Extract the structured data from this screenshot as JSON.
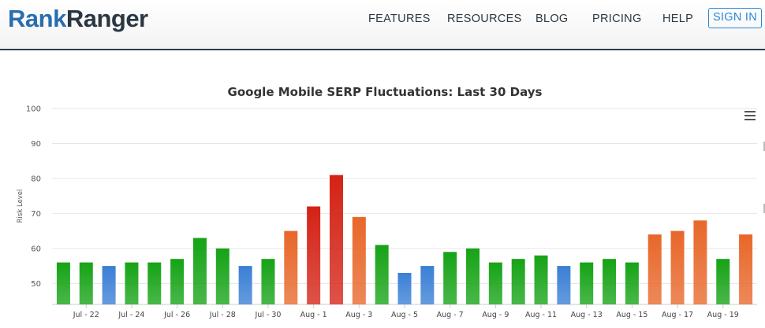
{
  "header": {
    "logo_part1": "Rank",
    "logo_part2": "Ranger",
    "nav": [
      {
        "id": "features",
        "label": "FEATURES"
      },
      {
        "id": "resources",
        "label": "RESOURCES"
      },
      {
        "id": "blog",
        "label": "BLOG"
      },
      {
        "id": "pricing",
        "label": "PRICING"
      },
      {
        "id": "help",
        "label": "HELP"
      }
    ],
    "signin_label": "SIGN IN"
  },
  "chart_data": {
    "type": "bar",
    "title": "Google Mobile SERP Fluctuations: Last 30 Days",
    "xlabel": "",
    "ylabel": "Risk Level",
    "ylim": [
      44,
      100
    ],
    "yticks": [
      50,
      60,
      70,
      80,
      90,
      100
    ],
    "grid": true,
    "xticks": [
      "Jul - 22",
      "Jul - 24",
      "Jul - 26",
      "Jul - 28",
      "Jul - 30",
      "Aug - 1",
      "Aug - 3",
      "Aug - 5",
      "Aug - 7",
      "Aug - 9",
      "Aug - 11",
      "Aug - 13",
      "Aug - 15",
      "Aug - 17",
      "Aug - 19"
    ],
    "values": [
      56,
      56,
      55,
      56,
      56,
      57,
      63,
      60,
      55,
      57,
      65,
      72,
      81,
      69,
      61,
      53,
      55,
      59,
      60,
      56,
      57,
      58,
      55,
      56,
      57,
      56,
      64,
      65,
      68,
      57,
      64
    ],
    "colors": {
      "green": "#16a316",
      "blue": "#3a7fd5",
      "orange": "#e8672a",
      "red": "#d42215"
    },
    "bar_color_keys": [
      "green",
      "green",
      "blue",
      "green",
      "green",
      "green",
      "green",
      "green",
      "blue",
      "green",
      "orange",
      "red",
      "red",
      "orange",
      "green",
      "blue",
      "blue",
      "green",
      "green",
      "green",
      "green",
      "green",
      "blue",
      "green",
      "green",
      "green",
      "orange",
      "orange",
      "orange",
      "green",
      "orange"
    ]
  }
}
